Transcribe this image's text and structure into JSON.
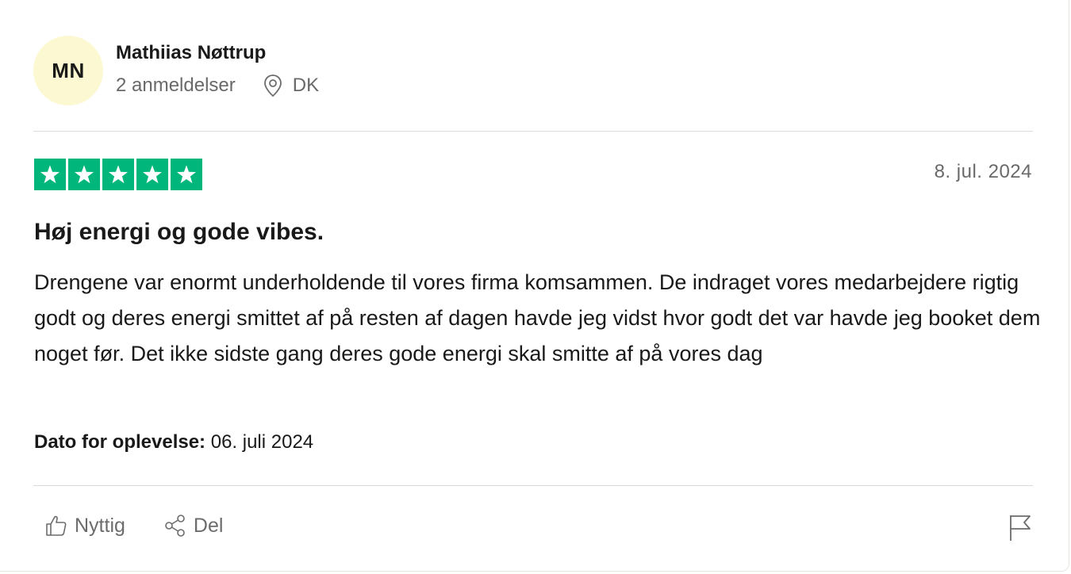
{
  "reviewer": {
    "initials": "MN",
    "name": "Mathiias Nøttrup",
    "reviews_count": "2 anmeldelser",
    "country": "DK",
    "location_icon": "location-pin-icon"
  },
  "review": {
    "rating": 5,
    "rating_max": 5,
    "date": "8. jul. 2024",
    "title": "Høj energi og gode vibes.",
    "body": "Drengene var enormt underholdende til vores firma komsammen. De indraget vores medarbejdere rigtig godt og deres energi smittet af på resten af dagen havde jeg vidst hvor godt det var havde jeg booket dem noget før. Det ikke sidste gang deres gode energi skal smitte af på vores dag",
    "experience_label": "Dato for oplevelse:",
    "experience_date": " 06. juli 2024"
  },
  "actions": {
    "helpful_label": "Nyttig",
    "share_label": "Del"
  },
  "colors": {
    "star_green": "#00b67a",
    "avatar_bg": "#fcf8d2",
    "muted_text": "#696969"
  }
}
